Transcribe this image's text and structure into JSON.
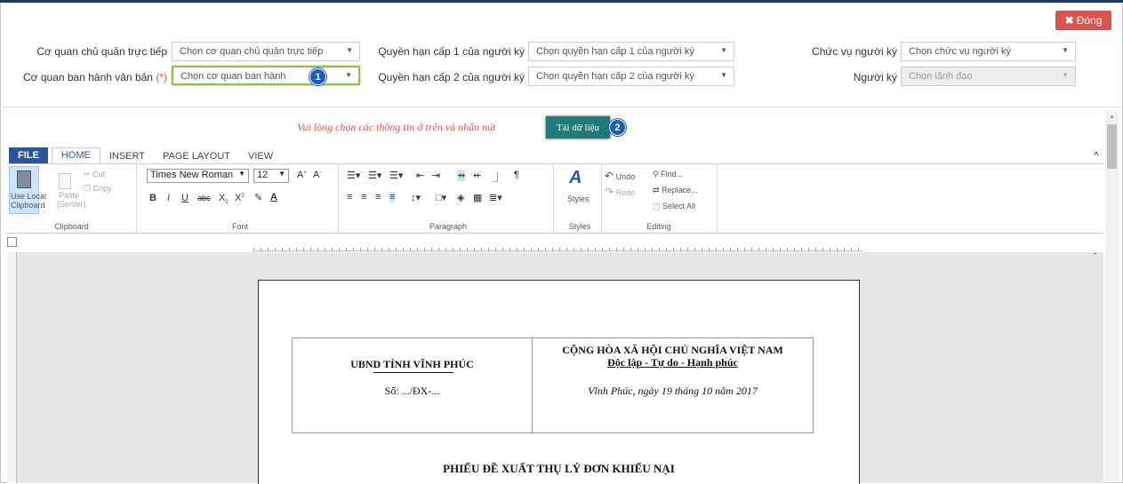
{
  "header": {
    "close_label": "Đóng",
    "close_icon": "close-icon"
  },
  "form": {
    "row1": [
      {
        "label": "Cơ quan chủ quản trực tiếp",
        "value": "Chọn cơ quan chủ quản trực tiếp"
      },
      {
        "label": "Quyền hạn cấp 1 của người ký",
        "value": "Chọn quyền hạn cấp 1 của người ký"
      },
      {
        "label": "Chức vụ người ký",
        "value": "Chọn chức vụ người ký"
      }
    ],
    "row2": [
      {
        "label": "Cơ quan ban hành văn bản",
        "required": "(*)",
        "value": "Chọn cơ quan ban hành"
      },
      {
        "label": "Quyền hạn cấp 2 của người ký",
        "value": "Chọn quyền hạn cấp 2 của người ký"
      },
      {
        "label": "Người ký",
        "value": "Chọn lãnh đạo"
      }
    ],
    "badge1": "1",
    "badge2": "2",
    "notice": "Vui lòng chọn các thông tin ở trên và nhấn nút",
    "load_label": "Tải dữ liệu"
  },
  "ribbon": {
    "tabs": [
      "FILE",
      "HOME",
      "INSERT",
      "PAGE LAYOUT",
      "VIEW"
    ],
    "active_tab": "HOME",
    "clipboard": {
      "use_local": "Use Local",
      "clipboard": "Clipboard",
      "cut": "Cut",
      "copy": "Copy",
      "paste": "Paste",
      "server": "(Server)",
      "title": "Clipboard"
    },
    "font": {
      "family": "Times New Roman",
      "size": "12",
      "title": "Font"
    },
    "paragraph": {
      "title": "Paragraph"
    },
    "styles": {
      "label": "Styles",
      "title": "Styles"
    },
    "editing": {
      "undo": "Undo",
      "redo": "Redo",
      "find": "Find...",
      "replace": "Replace...",
      "select_all": "Select All",
      "title": "Editing"
    }
  },
  "document": {
    "org": "UBND TỈNH VĨNH PHÚC",
    "number": "Số: .../ĐX-...",
    "nation": "CỘNG HÒA XÃ HỘI CHỦ NGHĨA VIỆT NAM",
    "motto": "Độc lập - Tự do - Hạnh phúc",
    "date": "Vĩnh Phúc, ngày 19 tháng 10 năm 2017",
    "title": "PHIẾU ĐỀ XUẤT THỤ LÝ ĐƠN KHIẾU NẠI"
  }
}
